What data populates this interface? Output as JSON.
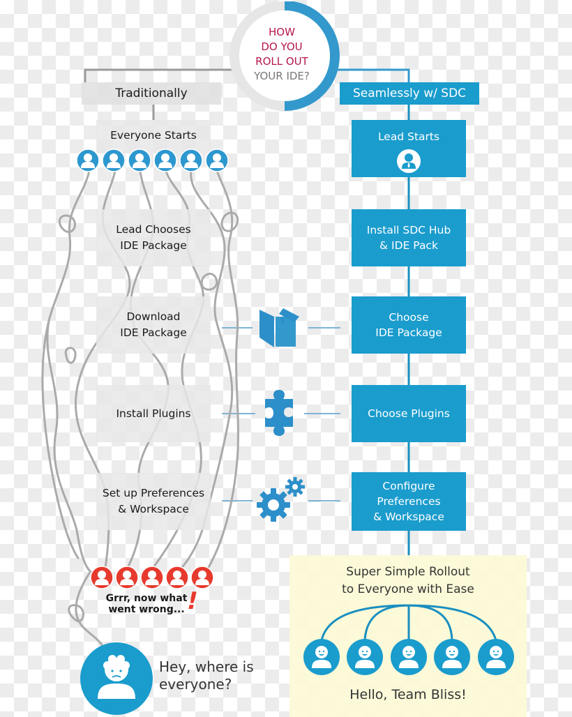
{
  "title": {
    "lines": [
      "HOW",
      "DO YOU",
      "ROLL OUT",
      "YOUR IDE?"
    ],
    "accent_color": "#b5174e",
    "ring_color": "#3399cc"
  },
  "columns": {
    "left_header": "Traditionally",
    "right_header": "Seamlessly w/ SDC"
  },
  "traditional_steps": [
    {
      "label": "Everyone Starts"
    },
    {
      "label": "Lead Chooses\nIDE Package"
    },
    {
      "label": "Download\nIDE Package"
    },
    {
      "label": "Install Plugins"
    },
    {
      "label": "Set up Preferences\n& Workspace"
    }
  ],
  "sdc_steps": [
    {
      "label": "Lead Starts"
    },
    {
      "label": "Install SDC Hub\n& IDE Pack"
    },
    {
      "label": "Choose\nIDE Package"
    },
    {
      "label": "Choose Plugins"
    },
    {
      "label": "Configure\nPreferences\n& Workspace"
    }
  ],
  "connector_icons": [
    "box-icon",
    "puzzle-piece-icon",
    "gears-icon"
  ],
  "traditional_outcome": {
    "frustrated_users": 5,
    "caption_lines": [
      "Grrr, now what",
      "went wrong..."
    ],
    "exclamation": "!",
    "lonely_lead_text_lines": [
      "Hey, where is",
      "everyone?"
    ]
  },
  "sdc_outcome": {
    "title_lines": [
      "Super Simple Rollout",
      "to Everyone with Ease"
    ],
    "happy_users": 5,
    "footer": "Hello, Team Bliss!"
  },
  "colors": {
    "blue": "#1a9ccd",
    "red": "#e73a2e",
    "gray_box": "#e8e8e8",
    "cream": "#fcfad6"
  }
}
